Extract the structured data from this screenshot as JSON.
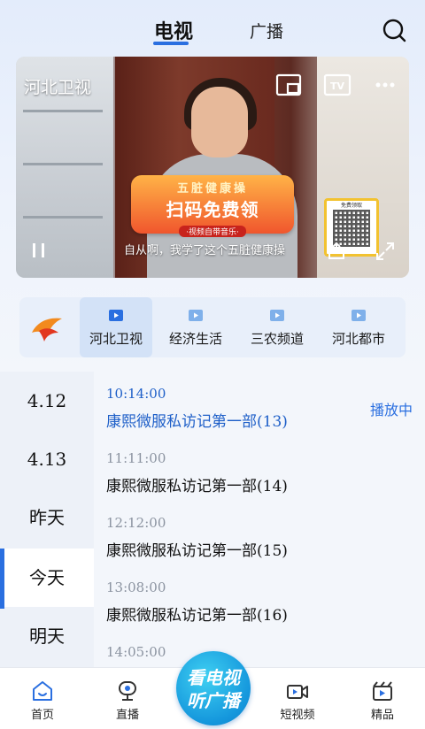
{
  "header": {
    "tabs": [
      {
        "label": "电视",
        "active": true
      },
      {
        "label": "广播",
        "active": false
      }
    ],
    "search_icon": "search-icon"
  },
  "player": {
    "channel_name": "河北卫视",
    "subtitle": "自从啊，我学了这个五脏健康操",
    "promo": {
      "top": "五脏健康操",
      "main": "扫码免费领",
      "sub": "·视频自带音乐·"
    },
    "qr_label": "免费领取",
    "controls": [
      "pip-icon",
      "tv-cast-icon",
      "more-icon",
      "pause-icon",
      "share-icon",
      "fullscreen-icon"
    ]
  },
  "channels": {
    "items": [
      {
        "label": "河北卫视",
        "active": true
      },
      {
        "label": "经济生活",
        "active": false
      },
      {
        "label": "三农频道",
        "active": false
      },
      {
        "label": "河北都市",
        "active": false
      }
    ],
    "accent": "#2a6fe0"
  },
  "schedule": {
    "dates": [
      {
        "label": "4.12",
        "active": false
      },
      {
        "label": "4.13",
        "active": false
      },
      {
        "label": "昨天",
        "active": false
      },
      {
        "label": "今天",
        "active": true
      },
      {
        "label": "明天",
        "active": false
      }
    ],
    "programs": [
      {
        "time": "10:14:00",
        "title": "康熙微服私访记第一部(13)",
        "status": "播放中"
      },
      {
        "time": "11:11:00",
        "title": "康熙微服私访记第一部(14)",
        "status": ""
      },
      {
        "time": "12:12:00",
        "title": "康熙微服私访记第一部(15)",
        "status": ""
      },
      {
        "time": "13:08:00",
        "title": "康熙微服私访记第一部(16)",
        "status": ""
      },
      {
        "time": "14:05:00",
        "title": "",
        "status": ""
      }
    ]
  },
  "bottom_nav": {
    "items": [
      {
        "label": "首页",
        "icon": "home-icon"
      },
      {
        "label": "直播",
        "icon": "live-icon"
      },
      {
        "label": "短视频",
        "icon": "short-video-icon"
      },
      {
        "label": "精品",
        "icon": "premium-icon"
      }
    ],
    "center": {
      "line1": "看电视",
      "line2": "听广播"
    }
  }
}
